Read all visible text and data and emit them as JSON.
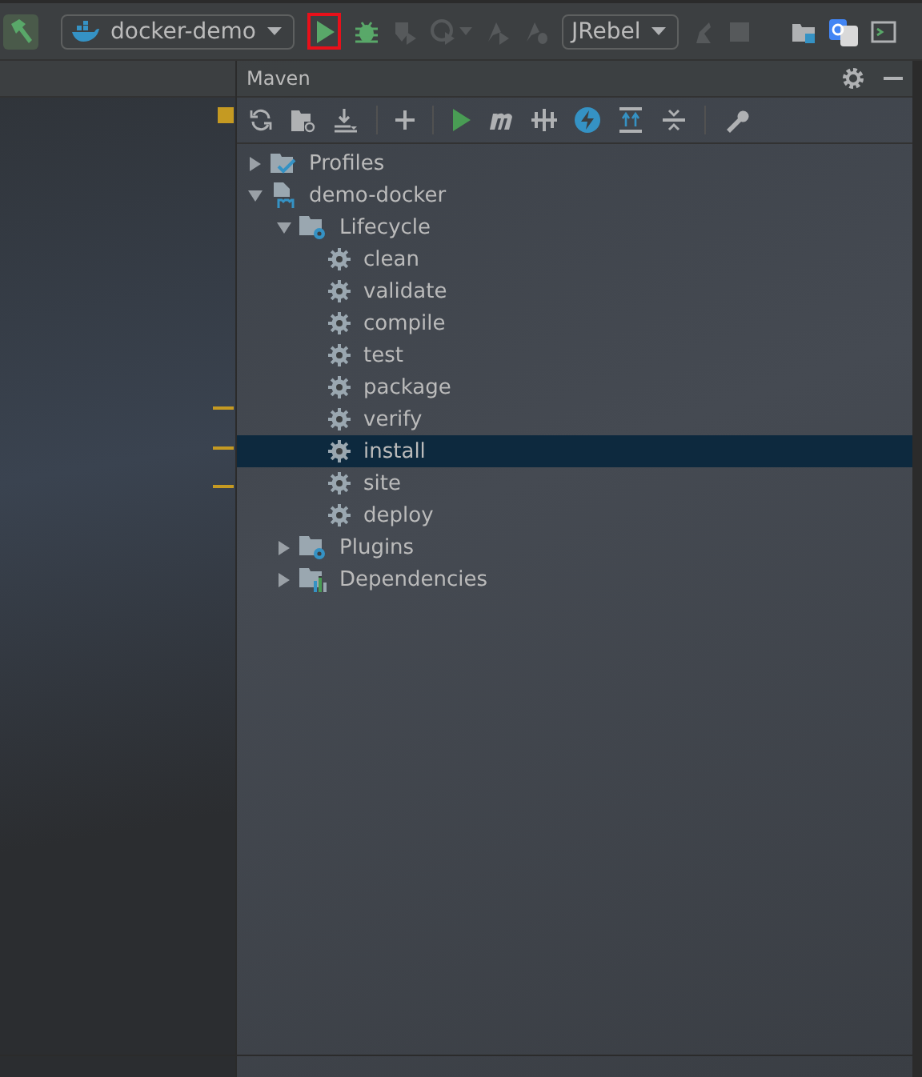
{
  "main_toolbar": {
    "configuration": "docker-demo",
    "jrebel_configuration": "JRebel",
    "run_highlighted": true
  },
  "maven": {
    "title": "Maven",
    "tree": [
      {
        "kind": "profiles",
        "label": "Profiles",
        "expanded": false,
        "selected": false
      },
      {
        "kind": "module",
        "label": "demo-docker",
        "expanded": true,
        "selected": false,
        "children": [
          {
            "kind": "lifecycle",
            "label": "Lifecycle",
            "expanded": true,
            "selected": false,
            "children": [
              {
                "kind": "goal",
                "label": "clean",
                "selected": false
              },
              {
                "kind": "goal",
                "label": "validate",
                "selected": false
              },
              {
                "kind": "goal",
                "label": "compile",
                "selected": false
              },
              {
                "kind": "goal",
                "label": "test",
                "selected": false
              },
              {
                "kind": "goal",
                "label": "package",
                "selected": false
              },
              {
                "kind": "goal",
                "label": "verify",
                "selected": false
              },
              {
                "kind": "goal",
                "label": "install",
                "selected": true
              },
              {
                "kind": "goal",
                "label": "site",
                "selected": false
              },
              {
                "kind": "goal",
                "label": "deploy",
                "selected": false
              }
            ]
          },
          {
            "kind": "plugins",
            "label": "Plugins",
            "expanded": false,
            "selected": false
          },
          {
            "kind": "dependencies",
            "label": "Dependencies",
            "expanded": false,
            "selected": false
          }
        ]
      }
    ]
  }
}
